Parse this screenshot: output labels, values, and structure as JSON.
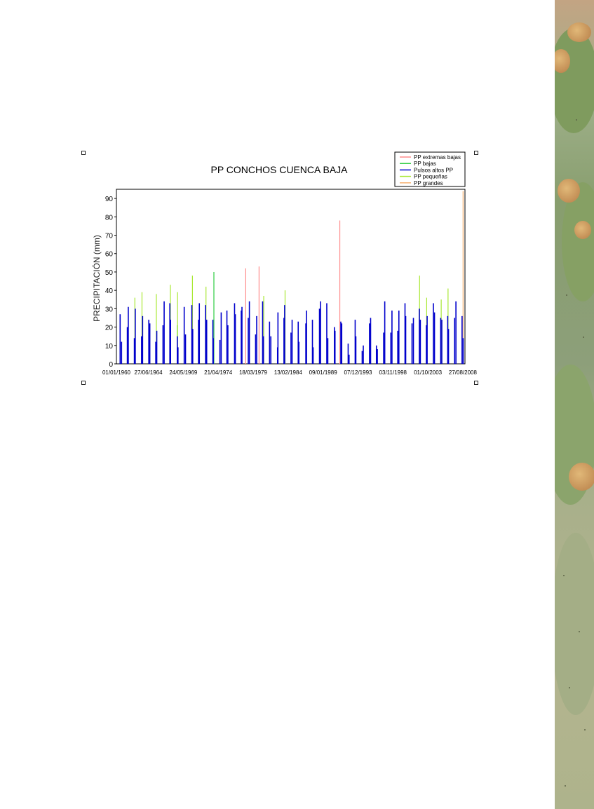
{
  "chart_data": {
    "type": "bar",
    "title": "PP CONCHOS CUENCA BAJA",
    "xlabel": "",
    "ylabel": "PRECIPITACIÓN (mm)",
    "ylim": [
      0,
      95
    ],
    "xlim": [
      "01/01/1960",
      "16/12/2008"
    ],
    "y_ticks": [
      "0",
      "10",
      "20",
      "30",
      "40",
      "50",
      "60",
      "70",
      "80",
      "90"
    ],
    "x_ticks": [
      "01/01/1960",
      "27/06/1964",
      "24/05/1969",
      "21/04/1974",
      "18/03/1979",
      "13/02/1984",
      "09/01/1989",
      "07/12/1993",
      "03/11/1998",
      "01/10/2003",
      "27/08/2008"
    ],
    "grid": false,
    "legend_position": "top-right",
    "series": [
      {
        "name": "PP extremas bajas",
        "color": "#ff8c8c",
        "x": [
          "01/03/1978",
          "15/01/1980",
          "20/05/1991"
        ],
        "values": [
          52,
          53,
          78
        ]
      },
      {
        "name": "PP bajas",
        "color": "#2ecc40",
        "x": [
          "20/07/1968",
          "10/09/1973"
        ],
        "values": [
          21,
          50
        ]
      },
      {
        "name": "Pulsos altos PP",
        "color": "#0000cc",
        "x": [
          "10/07/1960",
          "20/09/1960",
          "15/07/1961",
          "01/09/1961",
          "10/07/1962",
          "25/08/1962",
          "15/07/1963",
          "05/09/1963",
          "20/07/1964",
          "10/09/1964",
          "12/07/1965",
          "01/09/1965",
          "18/07/1966",
          "15/09/1966",
          "05/07/1967",
          "10/08/1967",
          "20/07/1968",
          "25/08/1968",
          "10/07/1969",
          "15/09/1969",
          "05/08/1970",
          "20/09/1970",
          "15/07/1971",
          "25/08/1971",
          "10/07/1972",
          "05/09/1972",
          "20/07/1973",
          "10/08/1973",
          "15/07/1974",
          "20/09/1974",
          "10/07/1975",
          "28/08/1975",
          "05/08/1976",
          "15/09/1976",
          "15/07/1977",
          "20/08/1977",
          "10/07/1978",
          "05/09/1978",
          "20/07/1979",
          "15/09/1979",
          "15/07/1980",
          "25/08/1980",
          "05/07/1981",
          "10/09/1981",
          "20/08/1982",
          "10/09/1982",
          "15/07/1983",
          "20/08/1983",
          "10/07/1984",
          "05/09/1984",
          "15/07/1985",
          "20/08/1985",
          "10/08/1986",
          "15/09/1986",
          "15/07/1987",
          "20/08/1987",
          "10/07/1988",
          "05/09/1988",
          "20/07/1989",
          "10/09/1989",
          "15/08/1990",
          "15/09/1990",
          "10/07/1991",
          "25/08/1991",
          "20/07/1992",
          "05/09/1992",
          "15/07/1993",
          "20/08/1993",
          "10/07/1994",
          "05/09/1994",
          "20/07/1995",
          "15/09/1995",
          "10/07/1996",
          "25/08/1996",
          "15/07/1997",
          "10/09/1997",
          "20/07/1998",
          "15/09/1998",
          "10/07/1999",
          "05/09/1999",
          "15/07/2000",
          "20/08/2000",
          "10/07/2001",
          "20/09/2001",
          "20/07/2002",
          "10/09/2002",
          "15/07/2003",
          "25/08/2003",
          "10/07/2004",
          "05/09/2004",
          "20/07/2005",
          "15/09/2005",
          "15/07/2006",
          "25/08/2006",
          "05/07/2007",
          "10/09/2007",
          "20/07/2008",
          "15/09/2008"
        ],
        "values": [
          27,
          12,
          20,
          31,
          14,
          30,
          15,
          26,
          24,
          22,
          12,
          18,
          21,
          34,
          33,
          24,
          15,
          9,
          31,
          16,
          32,
          19,
          24,
          33,
          32,
          24,
          24,
          14,
          13,
          28,
          29,
          21,
          33,
          27,
          29,
          31,
          25,
          34,
          16,
          26,
          34,
          15,
          23,
          15,
          9,
          28,
          25,
          32,
          17,
          24,
          23,
          12,
          22,
          29,
          24,
          9,
          30,
          34,
          33,
          14,
          20,
          18,
          23,
          22,
          11,
          5,
          24,
          15,
          7,
          10,
          22,
          25,
          10,
          8,
          17,
          34,
          17,
          29,
          18,
          29,
          33,
          26,
          22,
          25,
          30,
          24,
          21,
          26,
          33,
          28,
          25,
          24,
          26,
          19,
          25,
          34,
          26,
          14
        ]
      },
      {
        "name": "PP pequeñas",
        "color": "#a8e832",
        "x": [
          "05/08/1962",
          "05/08/1963",
          "10/08/1965",
          "01/08/1967",
          "01/08/1968",
          "05/09/1970",
          "01/08/1972",
          "10/09/1980",
          "10/09/1983",
          "01/08/2002",
          "01/08/2003",
          "15/08/2005",
          "01/08/2006"
        ],
        "values": [
          36,
          39,
          38,
          43,
          39,
          48,
          42,
          37,
          40,
          48,
          36,
          35,
          41
        ]
      },
      {
        "name": "PP grandes",
        "color": "#f5b070",
        "x": [
          "10/09/2008"
        ],
        "values": [
          94
        ]
      }
    ]
  }
}
